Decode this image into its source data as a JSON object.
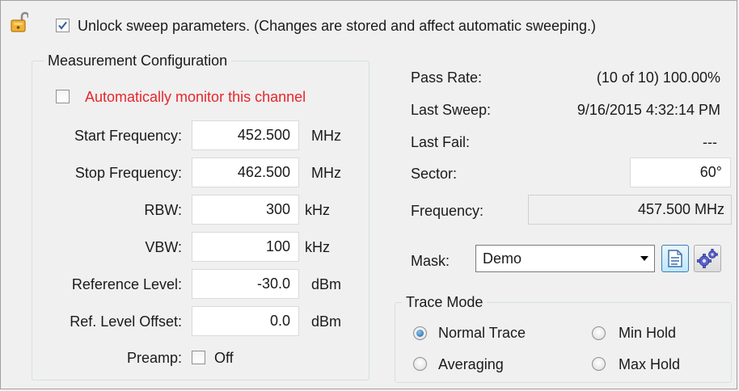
{
  "header": {
    "unlock_label": "Unlock sweep parameters.  (Changes are stored and affect automatic sweeping.)",
    "unlock_checked": true
  },
  "measurement": {
    "group_title": "Measurement Configuration",
    "auto_monitor_label": "Automatically monitor this channel",
    "auto_monitor_checked": false,
    "fields": [
      {
        "label": "Start Frequency:",
        "value": "452.500",
        "unit": "MHz"
      },
      {
        "label": "Stop Frequency:",
        "value": "462.500",
        "unit": "MHz"
      },
      {
        "label": "RBW:",
        "value": "300",
        "unit": "kHz"
      },
      {
        "label": "VBW:",
        "value": "100",
        "unit": "kHz"
      },
      {
        "label": "Reference Level:",
        "value": "-30.0",
        "unit": "dBm"
      },
      {
        "label": "Ref. Level Offset:",
        "value": "0.0",
        "unit": "dBm"
      }
    ],
    "preamp": {
      "label": "Preamp:",
      "state_label": "Off",
      "checked": false
    }
  },
  "status": {
    "pass_rate_label": "Pass Rate:",
    "pass_rate_value": "(10 of 10)  100.00%",
    "last_sweep_label": "Last Sweep:",
    "last_sweep_value": "9/16/2015 4:32:14 PM",
    "last_fail_label": "Last Fail:",
    "last_fail_value": "---",
    "sector_label": "Sector:",
    "sector_value": "60°",
    "frequency_label": "Frequency:",
    "frequency_value": "457.500 MHz",
    "mask_label": "Mask:",
    "mask_value": "Demo"
  },
  "trace_mode": {
    "group_title": "Trace Mode",
    "options": [
      {
        "label": "Normal Trace",
        "selected": true
      },
      {
        "label": "Min Hold",
        "selected": false
      },
      {
        "label": "Averaging",
        "selected": false
      },
      {
        "label": "Max Hold",
        "selected": false
      }
    ]
  },
  "colors": {
    "warning_text": "#e8262c",
    "radio_selected": "#1a5fa0",
    "lock_icon": "#e9a320"
  },
  "icons": {
    "lock": "unlocked-padlock-icon",
    "check": "checkmark-icon",
    "mask_edit": "document-icon",
    "mask_settings": "gears-icon",
    "dropdown": "chevron-down-icon"
  }
}
